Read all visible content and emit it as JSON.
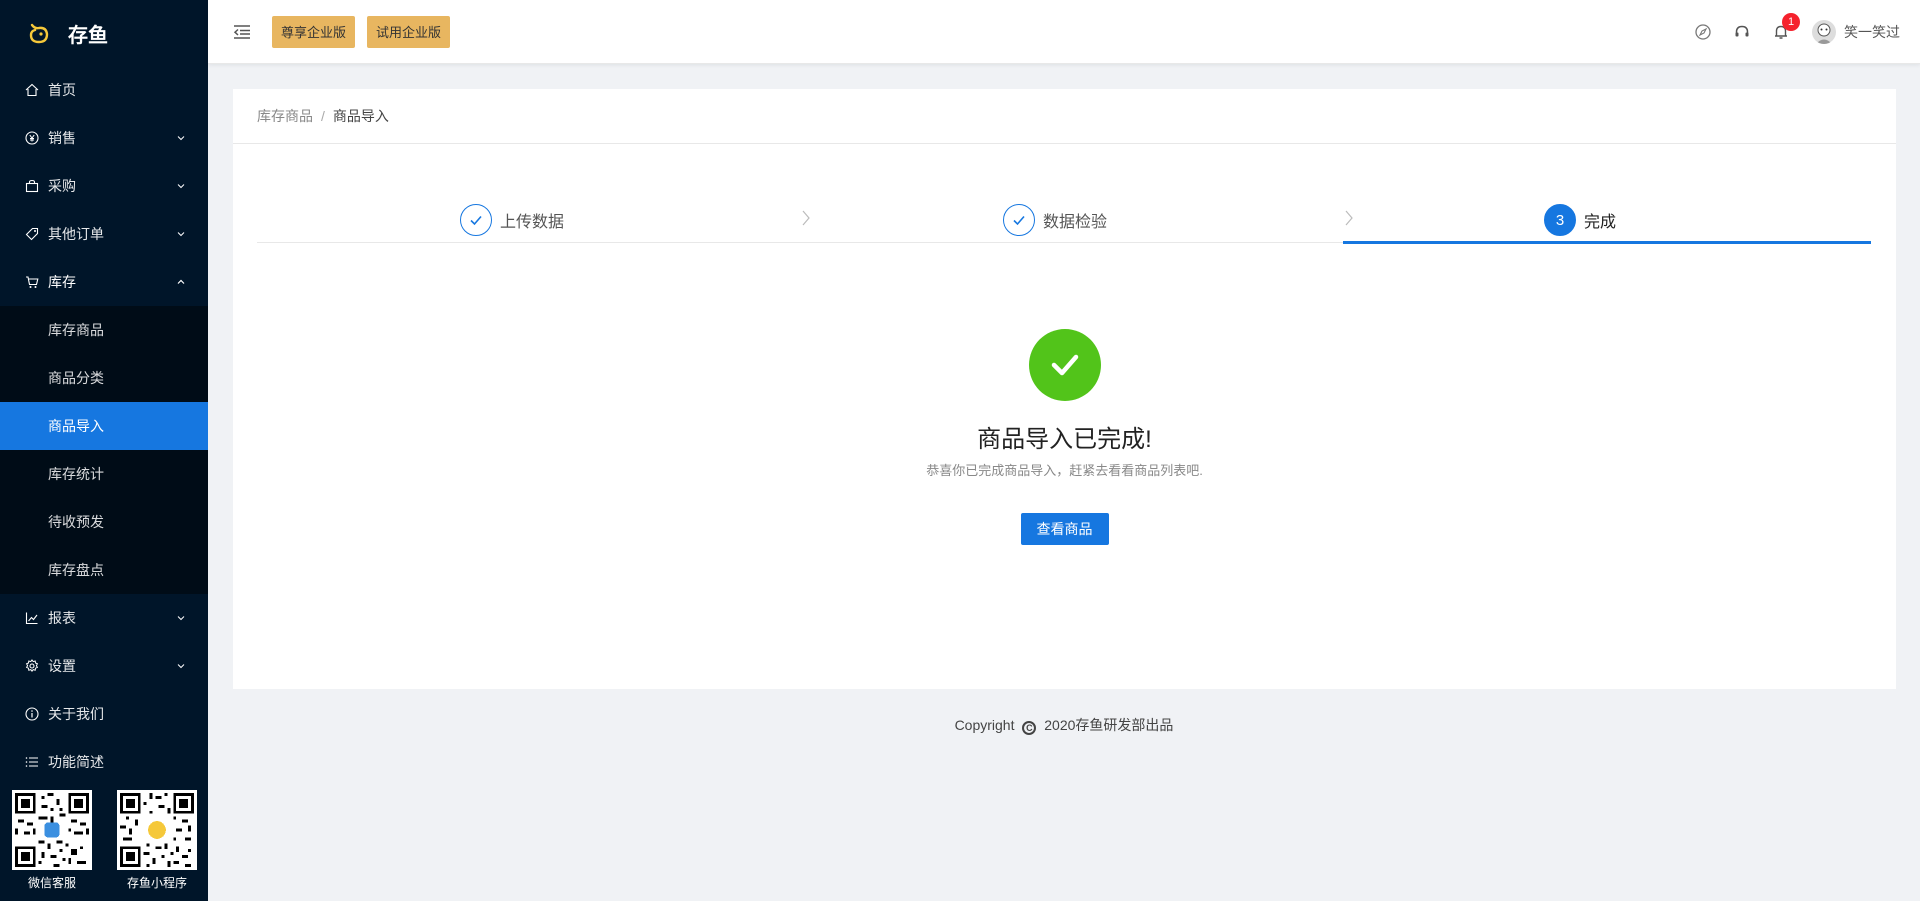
{
  "app": {
    "name": "存鱼",
    "brand_color": "#1677e0",
    "logo_color": "#f5c83a"
  },
  "sidebar": {
    "menu": [
      {
        "label": "首页",
        "icon": "home-icon"
      },
      {
        "label": "销售",
        "icon": "yen-icon"
      },
      {
        "label": "采购",
        "icon": "bag-icon"
      },
      {
        "label": "其他订单",
        "icon": "tag-icon"
      },
      {
        "label": "库存",
        "icon": "cart-icon",
        "expanded": true
      },
      {
        "label": "报表",
        "icon": "chart-icon"
      },
      {
        "label": "设置",
        "icon": "gear-icon"
      },
      {
        "label": "关于我们",
        "icon": "info-icon"
      },
      {
        "label": "功能简述",
        "icon": "list-icon"
      }
    ],
    "submenu": [
      "库存商品",
      "商品分类",
      "商品导入",
      "库存统计",
      "待收预发",
      "库存盘点"
    ],
    "active_submenu": "商品导入",
    "qr": [
      {
        "label": "微信客服"
      },
      {
        "label": "存鱼小程序"
      }
    ]
  },
  "header": {
    "edition_buttons": [
      "尊享企业版",
      "试用企业版"
    ],
    "notification_count": "1",
    "username": "笑一笑过"
  },
  "breadcrumb": {
    "parent": "库存商品",
    "separator": "/",
    "current": "商品导入"
  },
  "steps": [
    {
      "title": "上传数据",
      "status": "finish"
    },
    {
      "title": "数据检验",
      "status": "finish"
    },
    {
      "title": "完成",
      "number": "3",
      "status": "process"
    }
  ],
  "result": {
    "title": "商品导入已完成!",
    "subtitle": "恭喜你已完成商品导入，赶紧去看看商品列表吧.",
    "button": "查看商品",
    "status_color": "#52c41a"
  },
  "footer": {
    "prefix": "Copyright",
    "symbol": "C",
    "text": "2020存鱼研发部出品"
  }
}
